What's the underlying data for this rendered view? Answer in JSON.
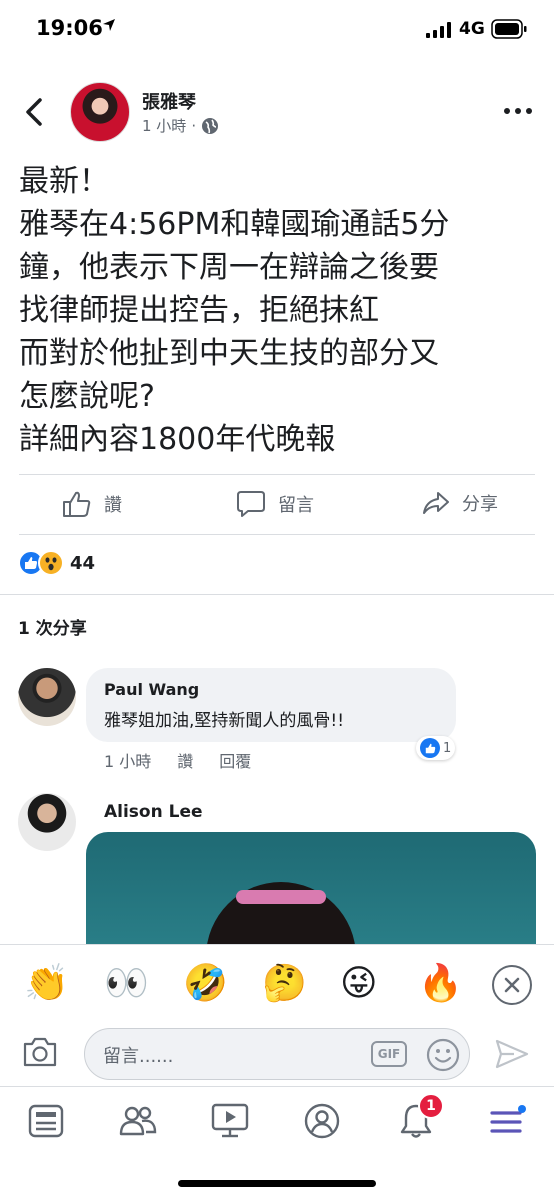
{
  "status_bar": {
    "time": "19:06",
    "network": "4G"
  },
  "post": {
    "author": "張雅琴",
    "time": "1 小時",
    "text_lines": [
      "最新！",
      "雅琴在4:56PM和韓國瑜通話5分",
      "鐘，他表示下周一在辯論之後要",
      "找律師提出控告，拒絕抹紅",
      "而對於他扯到中天生技的部分又",
      "怎麼說呢?",
      "詳細內容1800年代晚報"
    ]
  },
  "actions": {
    "like": "讚",
    "comment": "留言",
    "share": "分享"
  },
  "reactions": {
    "count": "44"
  },
  "shares_text": "1 次分享",
  "comments": [
    {
      "name": "Paul Wang",
      "text": "雅琴姐加油,堅持新聞人的風骨!!",
      "time": "1 小時",
      "like": "讚",
      "reply": "回覆",
      "like_count": "1"
    },
    {
      "name": "Alison Lee"
    }
  ],
  "emoji_bar": [
    "👏",
    "👀",
    "🤣",
    "🤔",
    "😜",
    "🔥"
  ],
  "composer": {
    "placeholder": "留言......",
    "gif_label": "GIF"
  },
  "tab_bar": {
    "notification_count": "1"
  },
  "colors": {
    "facebook_blue": "#1877f2",
    "badge_red": "#e41e3f",
    "menu_purple": "#5b55b7"
  }
}
